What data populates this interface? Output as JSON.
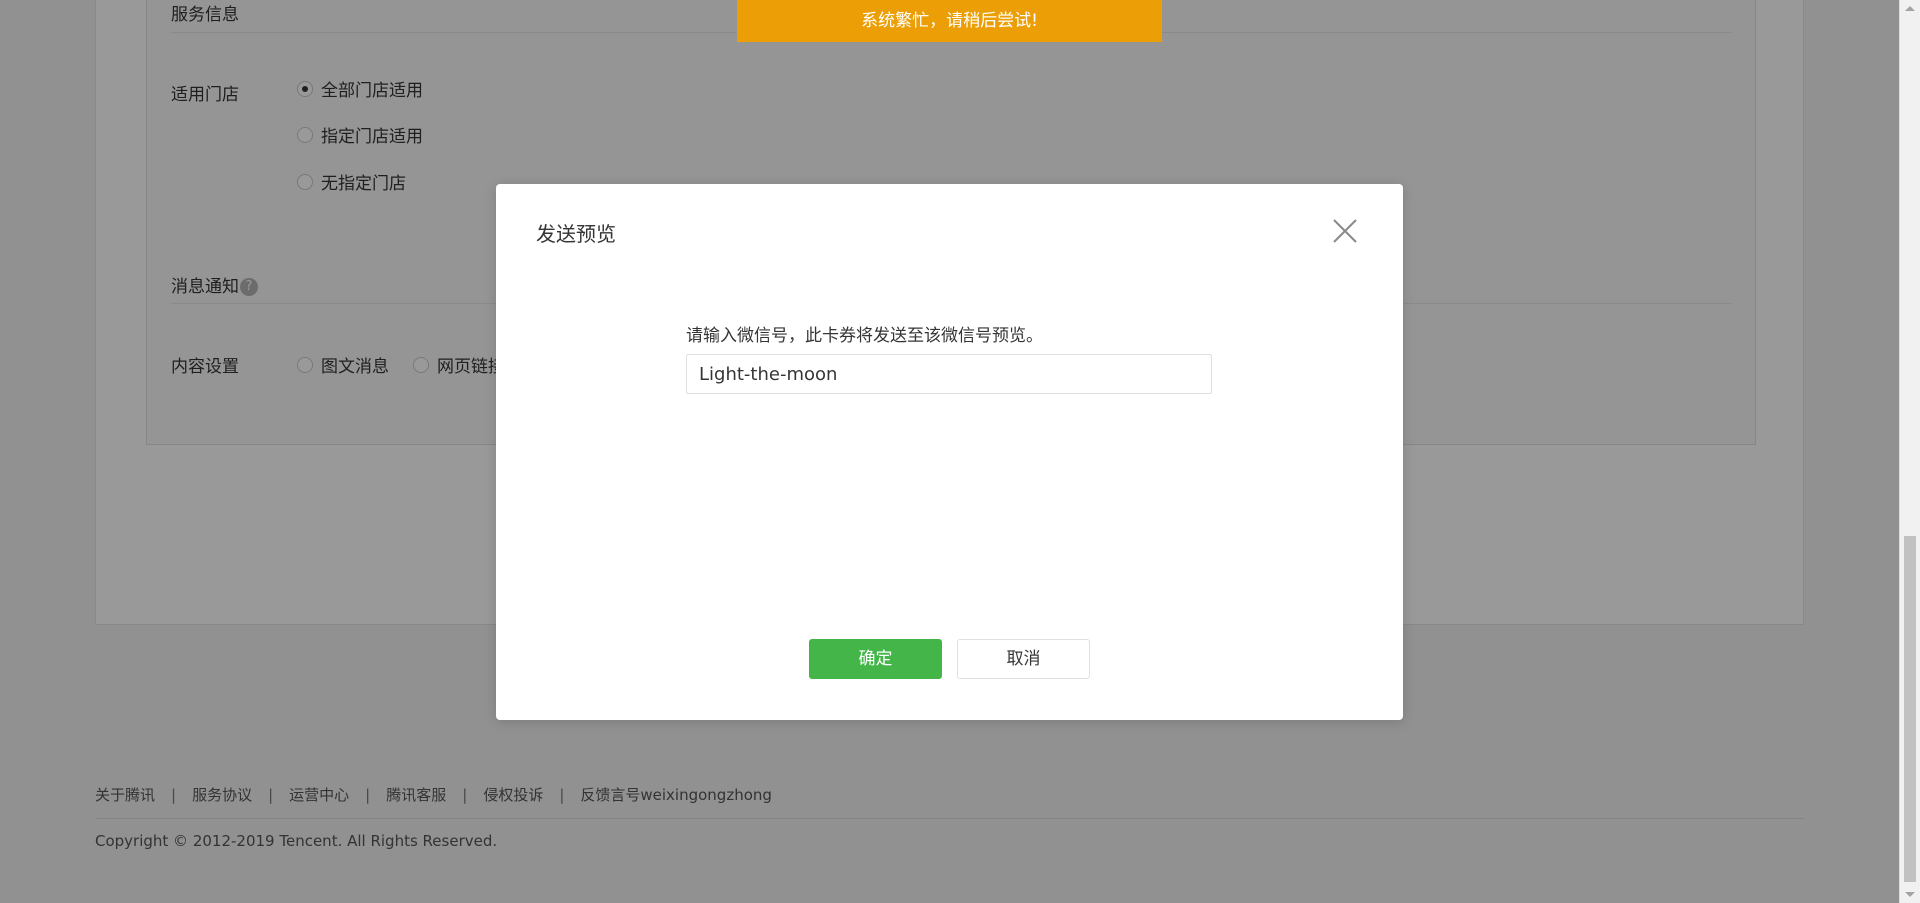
{
  "toast": {
    "text": "系统繁忙，请稍后尝试!",
    "color": "#eb9e05"
  },
  "form": {
    "service_info_title": "服务信息",
    "store_label": "适用门店",
    "store_options": [
      {
        "label": "全部门店适用",
        "checked": true
      },
      {
        "label": "指定门店适用",
        "checked": false
      },
      {
        "label": "无指定门店",
        "checked": false
      }
    ],
    "notice_title": "消息通知",
    "notice_help_icon": "question-circle-icon",
    "content_label": "内容设置",
    "content_options": [
      {
        "label": "图文消息",
        "checked": false
      },
      {
        "label": "网页链接",
        "checked": false
      }
    ]
  },
  "dialog": {
    "title": "发送预览",
    "close_icon": "close-icon",
    "description": "请输入微信号，此卡券将发送至该微信号预览。",
    "input_value": "Light-the-moon",
    "confirm_label": "确定",
    "cancel_label": "取消",
    "confirm_color": "#44b549"
  },
  "footer": {
    "links": [
      "关于腾讯",
      "服务协议",
      "运营中心",
      "腾讯客服",
      "侵权投诉",
      "反馈言号weixingongzhong"
    ],
    "separator": "|",
    "copyright": "Copyright © 2012-2019 Tencent. All Rights Reserved."
  }
}
